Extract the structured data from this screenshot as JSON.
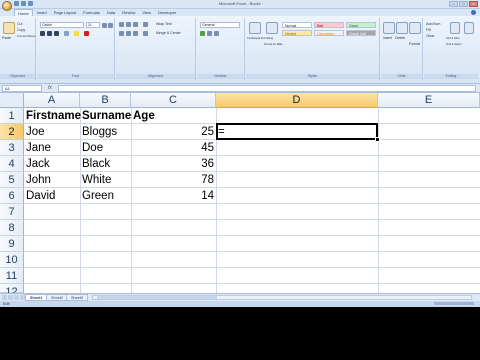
{
  "window": {
    "title": "Microsoft Excel - Book1",
    "controls": [
      "–",
      "□",
      "×"
    ]
  },
  "ribbon": {
    "tabs": [
      "Home",
      "Insert",
      "Page Layout",
      "Formulas",
      "Data",
      "Review",
      "View",
      "Developer"
    ],
    "active_tab": "Home",
    "groups": [
      {
        "label": "Clipboard",
        "items": [
          "Paste",
          "Cut",
          "Copy",
          "Format Painter"
        ]
      },
      {
        "label": "Font",
        "items": [
          "Calibri",
          "11"
        ]
      },
      {
        "label": "Alignment",
        "items": [
          "Wrap Text",
          "Merge & Center"
        ]
      },
      {
        "label": "Number",
        "items": [
          "General"
        ]
      },
      {
        "label": "Styles",
        "items": [
          "Conditional Formatting",
          "Format as Table",
          "Normal",
          "Bad",
          "Good",
          "Neutral",
          "Calculation",
          "Check Cell"
        ]
      },
      {
        "label": "Cells",
        "items": [
          "Insert",
          "Delete",
          "Format"
        ]
      },
      {
        "label": "Editing",
        "items": [
          "AutoSum",
          "Fill",
          "Clear",
          "Sort & Filter",
          "Find & Select"
        ]
      }
    ]
  },
  "formula_bar": {
    "name_box": "A1",
    "fx": "fx",
    "content": ""
  },
  "grid": {
    "columns": [
      "A",
      "B",
      "C",
      "D",
      "E"
    ],
    "selected_column": "D",
    "rows": [
      "1",
      "2",
      "3",
      "4",
      "5",
      "6",
      "7",
      "8",
      "9",
      "10",
      "11",
      "12"
    ],
    "selected_row": "2",
    "header_row": {
      "A": "Firstname",
      "B": "Surname",
      "C": "Age"
    },
    "data_rows": [
      {
        "A": "Joe",
        "B": "Bloggs",
        "C": "25",
        "D": "="
      },
      {
        "A": "Jane",
        "B": "Doe",
        "C": "45"
      },
      {
        "A": "Jack",
        "B": "Black",
        "C": "36"
      },
      {
        "A": "John",
        "B": "White",
        "C": "78"
      },
      {
        "A": "David",
        "B": "Green",
        "C": "14"
      }
    ]
  },
  "sheets": {
    "tabs": [
      "Sheet1",
      "Sheet2",
      "Sheet3"
    ],
    "active": "Sheet1"
  },
  "status": {
    "mode": "Edit"
  }
}
